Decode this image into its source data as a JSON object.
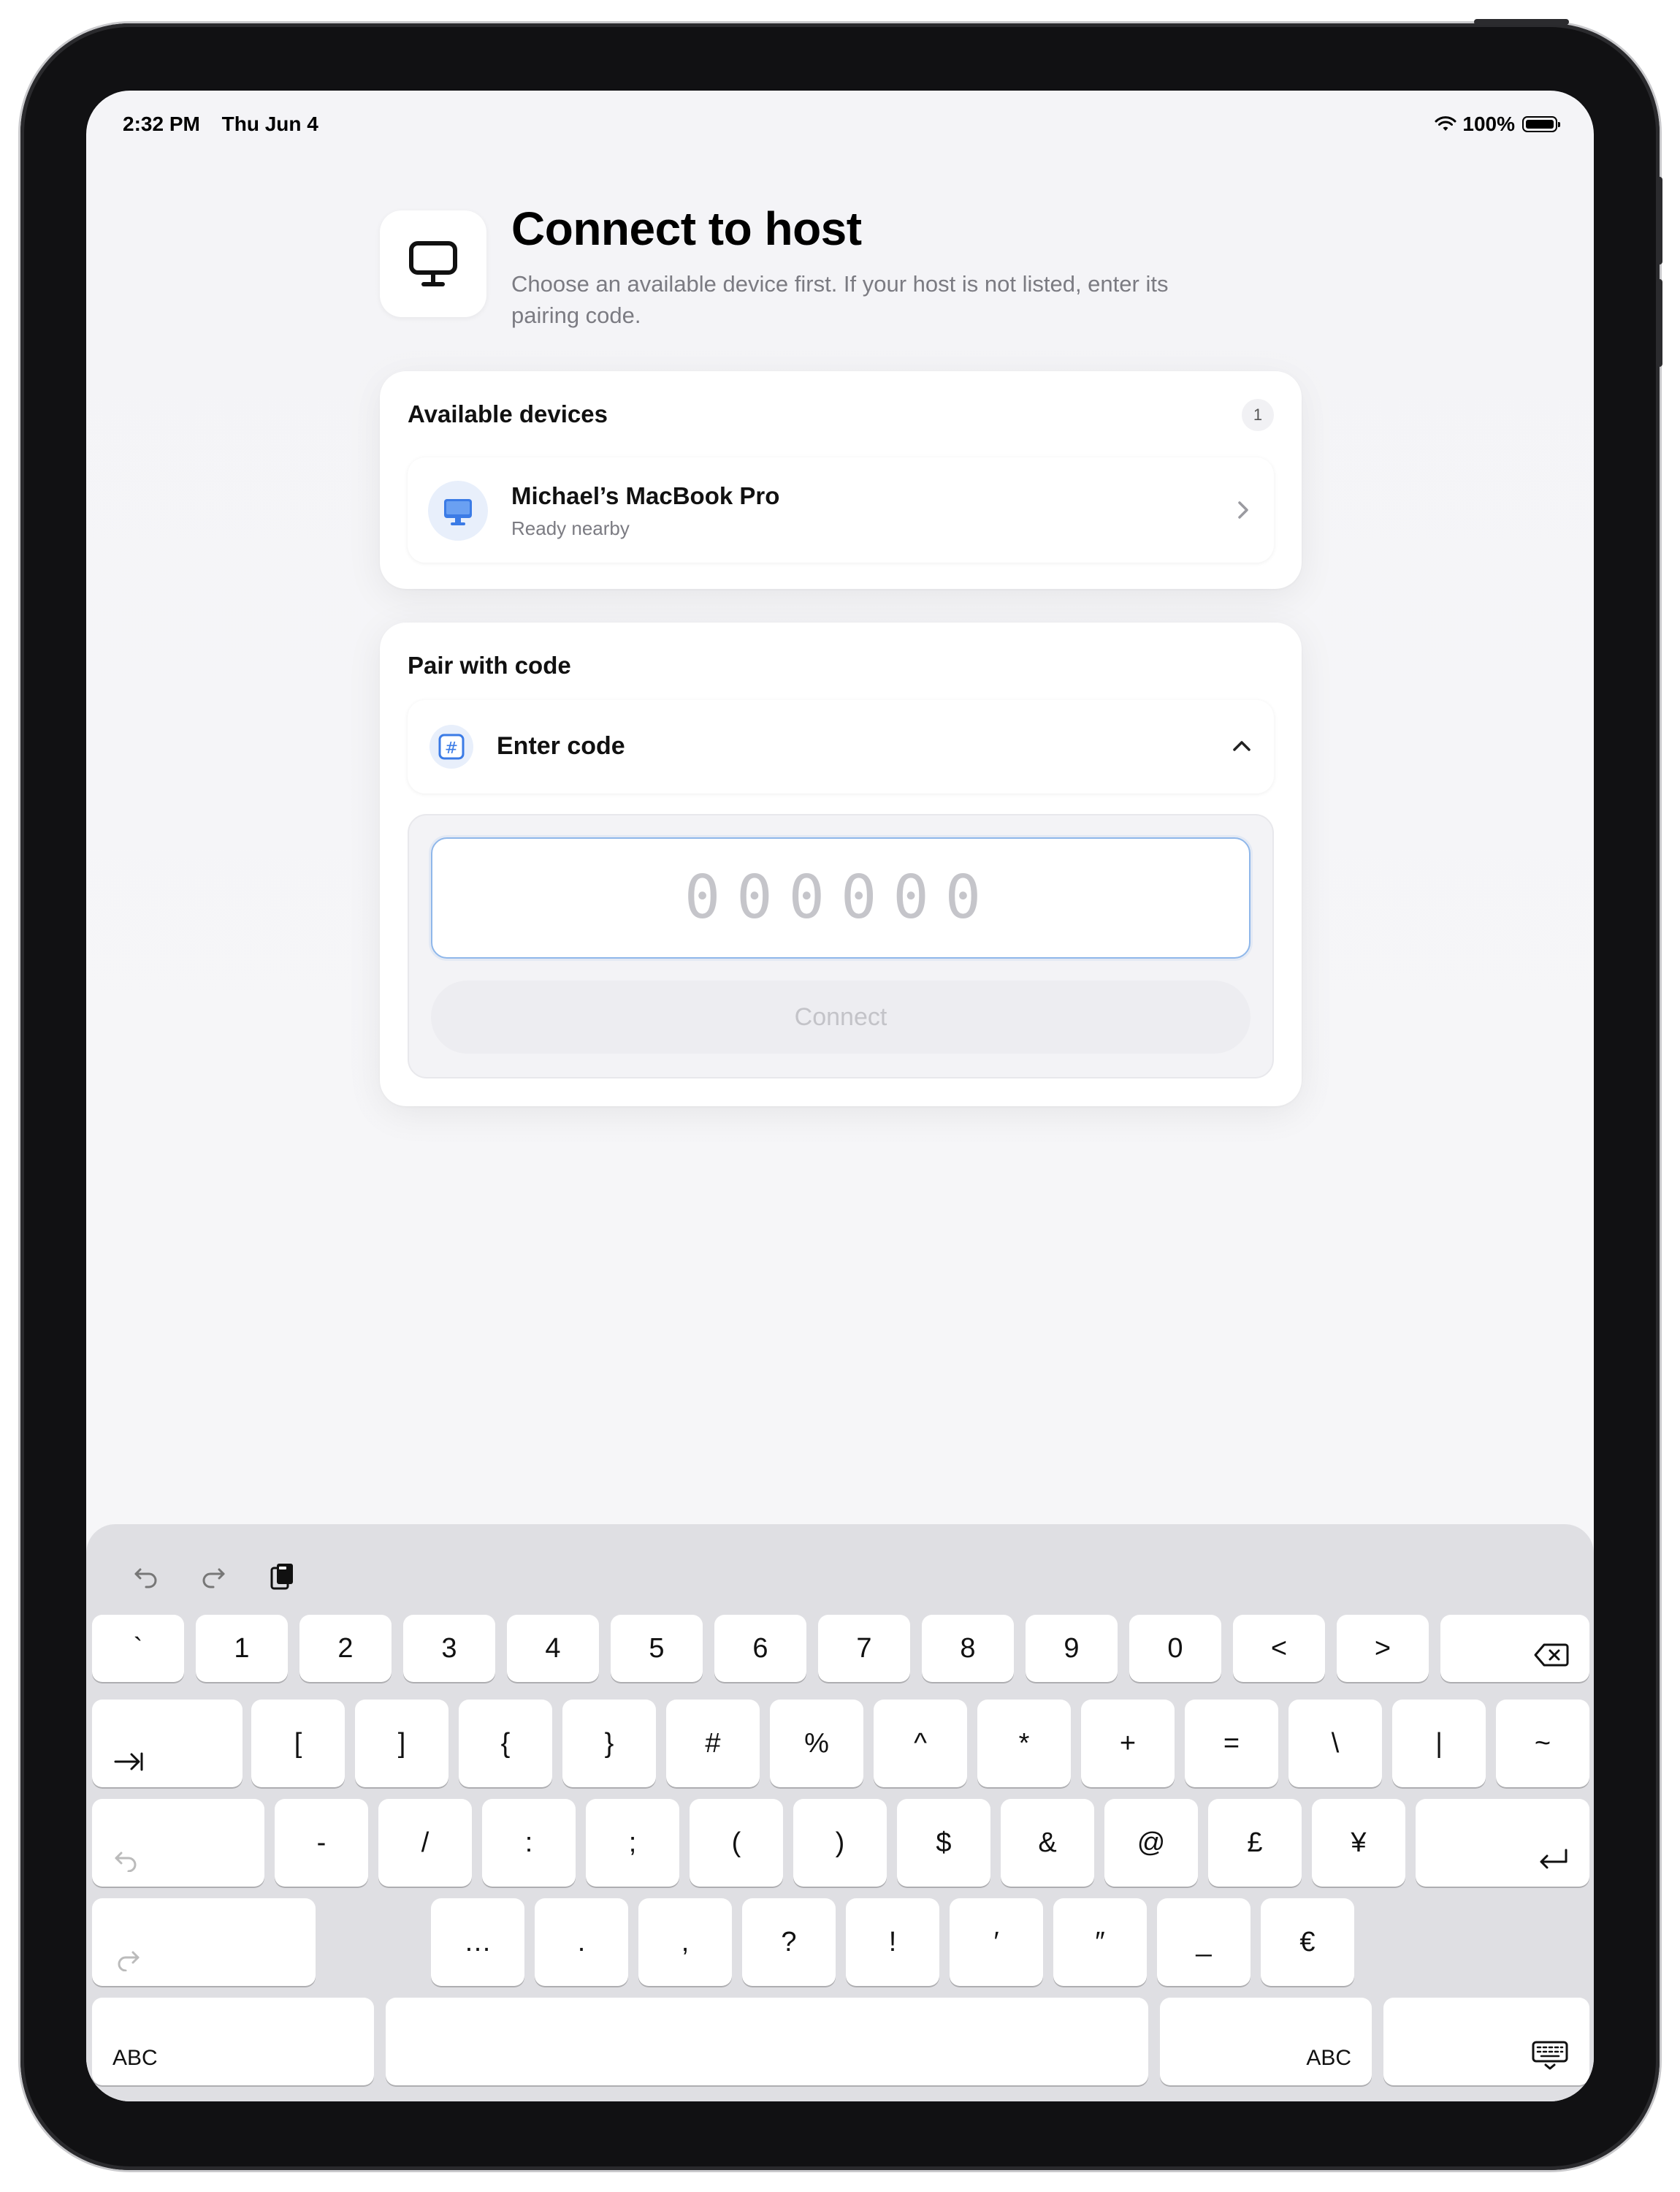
{
  "status_bar": {
    "time": "2:32 PM",
    "date": "Thu Jun 4",
    "battery": "100%"
  },
  "header": {
    "title": "Connect to host",
    "subtitle": "Choose an available device first. If your host is not listed, enter its pairing code."
  },
  "available_devices": {
    "title": "Available devices",
    "count": "1",
    "items": [
      {
        "name": "Michael’s MacBook Pro",
        "status": "Ready nearby"
      }
    ]
  },
  "pair": {
    "title": "Pair with code",
    "row_label": "Enter code",
    "code_placeholder": "000000",
    "connect_label": "Connect"
  },
  "keyboard": {
    "row1": [
      "`",
      "1",
      "2",
      "3",
      "4",
      "5",
      "6",
      "7",
      "8",
      "9",
      "0",
      "<",
      ">"
    ],
    "row2": [
      "[",
      "]",
      "{",
      "}",
      "#",
      "%",
      "^",
      "*",
      "+",
      "=",
      "\\",
      "|",
      "~"
    ],
    "row3": [
      "-",
      "/",
      ":",
      ";",
      "(",
      ")",
      "$",
      "&",
      "@",
      "£",
      "¥"
    ],
    "row4": [
      "…",
      ".",
      ",",
      "?",
      "!",
      "′",
      "″",
      "_",
      "€"
    ],
    "abc_left": "ABC",
    "abc_right": "ABC"
  },
  "colors": {
    "accent": "#4a86e8",
    "input_border": "#8fb7ea",
    "keyboard_bg": "#dfdfe3"
  }
}
